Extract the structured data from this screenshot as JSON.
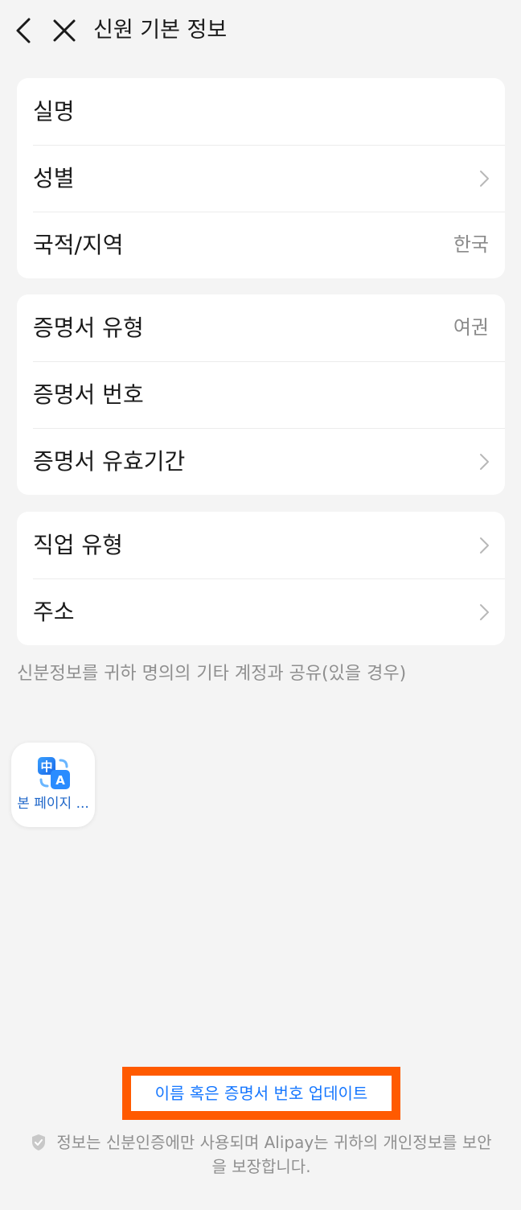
{
  "header": {
    "title": "신원 기본 정보"
  },
  "section1": [
    {
      "label": "실명",
      "value": "",
      "chevron": false
    },
    {
      "label": "성별",
      "value": "",
      "chevron": true
    },
    {
      "label": "국적/지역",
      "value": "한국",
      "chevron": false
    }
  ],
  "section2": [
    {
      "label": "증명서 유형",
      "value": "여권",
      "chevron": false
    },
    {
      "label": "증명서 번호",
      "value": "",
      "chevron": false
    },
    {
      "label": "증명서 유효기간",
      "value": "",
      "chevron": true
    }
  ],
  "section3": [
    {
      "label": "직업 유형",
      "value": "",
      "chevron": true
    },
    {
      "label": "주소",
      "value": "",
      "chevron": true
    }
  ],
  "note": "신분정보를 귀하 명의의 기타 계정과 공유(있을 경우)",
  "floating": {
    "label": "본 페이지 ...",
    "icon_top_char": "中",
    "icon_bottom_char": "A"
  },
  "update_link": "이름 혹은 증명서 번호 업데이트",
  "footer": "정보는 신분인증에만 사용되며 Alipay는 귀하의 개인정보를 보안을 보장합니다.",
  "colors": {
    "background": "#f4f4f4",
    "link": "#1677ff",
    "highlight": "#ff5a00"
  }
}
